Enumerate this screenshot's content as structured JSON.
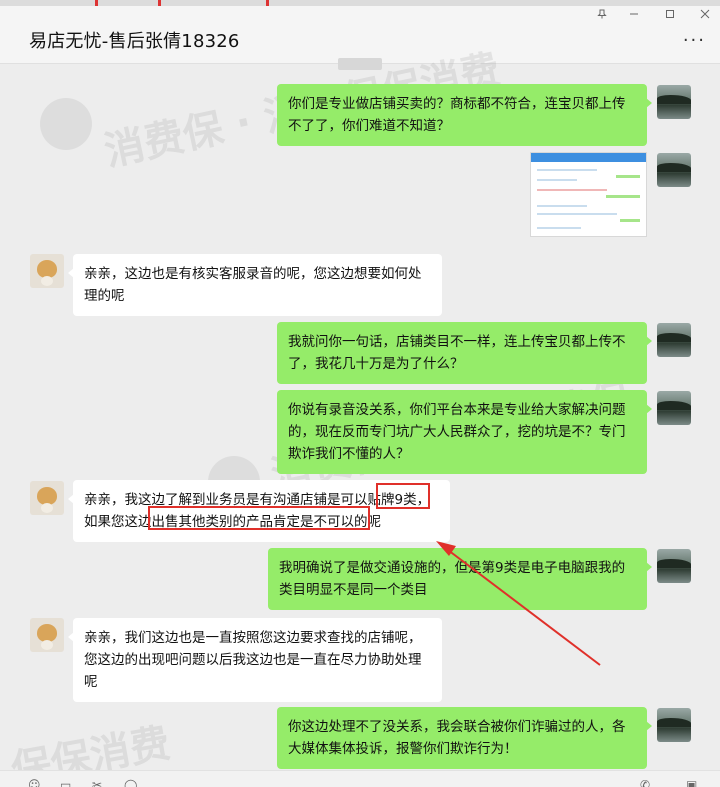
{
  "window": {
    "title": "易店无忧-售后张倩18326",
    "pin_icon": "pin-icon",
    "min_icon": "minimize-icon",
    "max_icon": "maximize-icon",
    "close_icon": "close-icon",
    "more_label": "···"
  },
  "watermarks": [
    "消费保 · 消费保保消费",
    "消费保",
    "消费保",
    "保保消费"
  ],
  "messages": [
    {
      "side": "right",
      "text": "你们是专业做店铺买卖的？商标都不符合，连宝贝都上传不了了，你们难道不知道？"
    },
    {
      "side": "right",
      "type": "image",
      "text": ""
    },
    {
      "side": "left",
      "text": "亲亲，这边也是有核实客服录音的呢，您这边想要如何处理的呢"
    },
    {
      "side": "right",
      "text": "我就问你一句话，店铺类目不一样，连上传宝贝都上传不了，我花几十万是为了什么？"
    },
    {
      "side": "right",
      "text": "你说有录音没关系，你们平台本来是专业给大家解决问题的，现在反而专门坑广大人民群众了，挖的坑是不？专门欺诈我们不懂的人？"
    },
    {
      "side": "left",
      "text": "亲亲，我这边了解到业务员是有沟通店铺是可以贴牌9类，如果您这边出售其他类别的产品肯定是不可以的呢"
    },
    {
      "side": "right",
      "text": "我明确说了是做交通设施的，但是第9类是电子电脑跟我的类目明显不是同一个类目"
    },
    {
      "side": "left",
      "text": "亲亲，我们这边也是一直按照您这边要求查找的店铺呢，您这边的出现吧问题以后我这边也是一直在尽力协助处理呢"
    },
    {
      "side": "right",
      "text": "你这边处理不了没关系，我会联合被你们诈骗过的人，各大媒体集体投诉，报警你们欺诈行为！"
    }
  ],
  "annotations": {
    "highlight_color": "#e0302a"
  }
}
